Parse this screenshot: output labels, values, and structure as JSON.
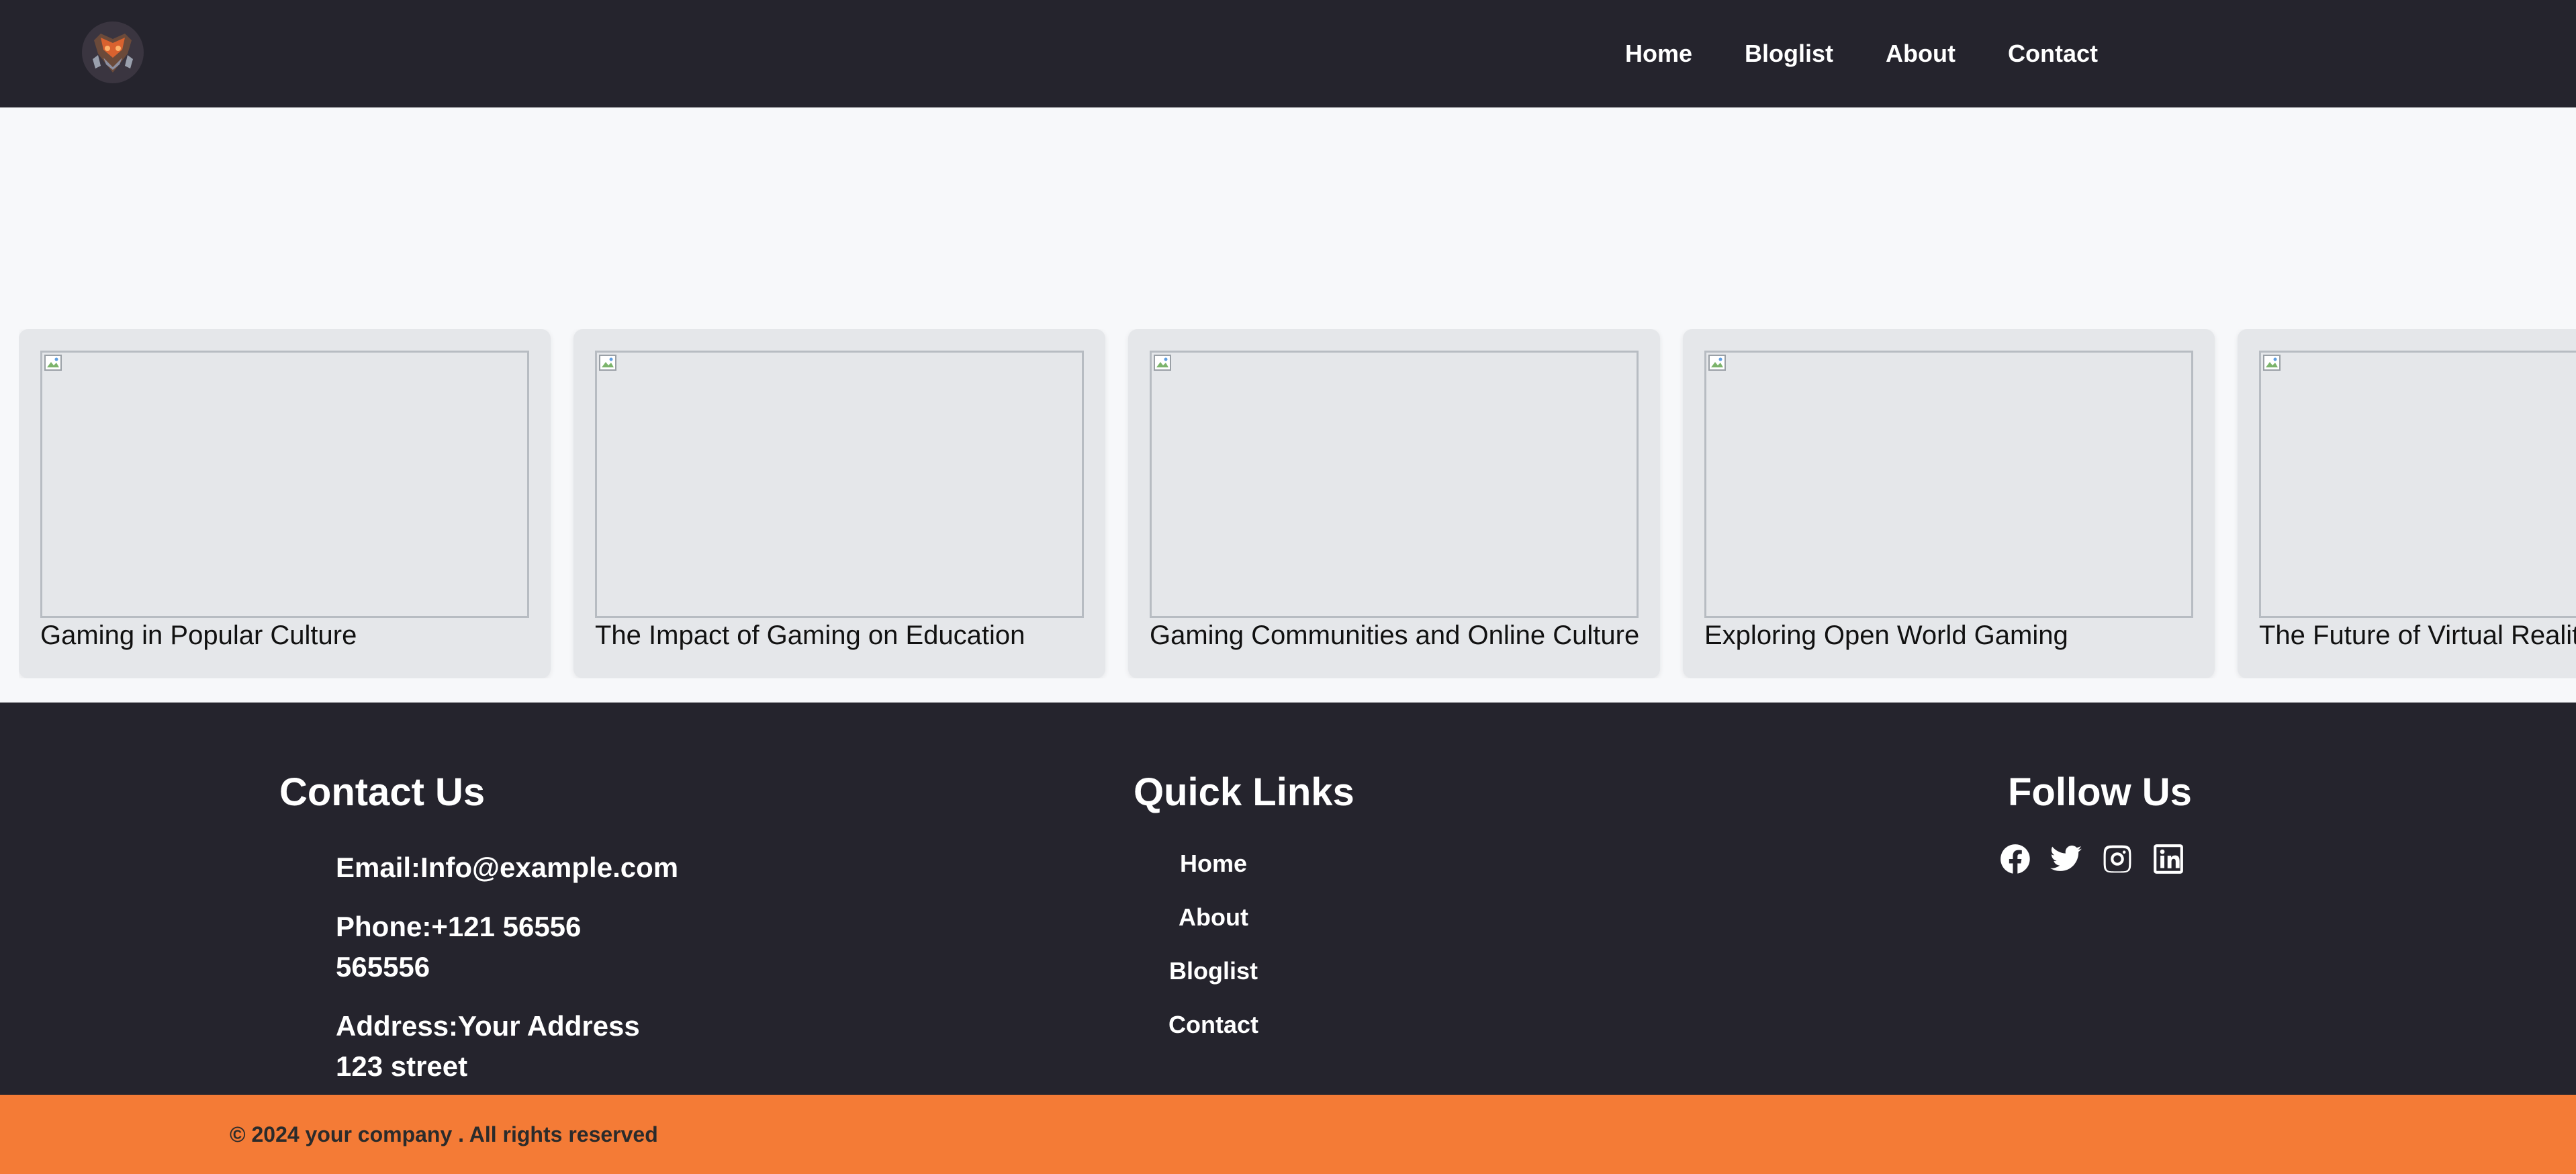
{
  "nav": {
    "logo_name": "gaming-mascot-logo",
    "links": [
      "Home",
      "Bloglist",
      "About",
      "Contact"
    ]
  },
  "cards": [
    {
      "title": "Gaming in Popular Culture"
    },
    {
      "title": "The Impact of Gaming on Education"
    },
    {
      "title": "Gaming Communities and Online Culture"
    },
    {
      "title": "Exploring Open World Gaming"
    },
    {
      "title": "The Future of Virtual Reality Gaming"
    }
  ],
  "footer": {
    "contact": {
      "title": "Contact Us",
      "email": "Email:Info@example.com",
      "phone": "Phone:+121 56556 565556",
      "address": "Address:Your Address 123 street"
    },
    "quick_links": {
      "title": "Quick Links",
      "items": [
        "Home",
        "About",
        "Bloglist",
        "Contact"
      ]
    },
    "follow": {
      "title": "Follow Us",
      "icons": [
        "facebook-icon",
        "twitter-icon",
        "instagram-icon",
        "linkedin-icon"
      ]
    }
  },
  "copyright": "© 2024 your company . All rights reserved",
  "colors": {
    "nav_bg": "#25242d",
    "footer_bg": "#25242d",
    "accent": "#f47b36",
    "card_bg": "#e5e7ea",
    "page_bg": "#f7f8fa"
  }
}
